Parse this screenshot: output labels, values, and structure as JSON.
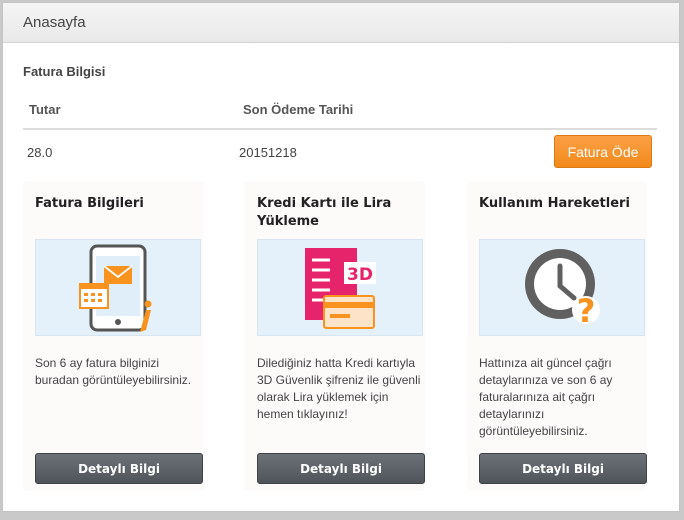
{
  "header": {
    "title": "Anasayfa"
  },
  "invoice": {
    "section_title": "Fatura Bilgisi",
    "columns": [
      "Tutar",
      "Son Ödeme Tarihi"
    ],
    "row": {
      "amount": "28.0",
      "due_date": "20151218"
    },
    "pay_label": "Fatura Öde"
  },
  "cards": [
    {
      "title": "Fatura Bilgileri",
      "icon": "phone-invoice-icon",
      "description": "Son 6 ay fatura bilginizi buradan görüntüleyebilirsiniz.",
      "button_label": "Detaylı Bilgi"
    },
    {
      "title": "Kredi Kartı ile Lira Yükleme",
      "icon": "credit-card-3d-icon",
      "description": "Dilediğiniz hatta Kredi kartıyla 3D Güvenlik şifreniz ile güvenli olarak Lira yüklemek için hemen tıklayınız!",
      "button_label": "Detaylı Bilgi"
    },
    {
      "title": "Kullanım Hareketleri",
      "icon": "clock-question-icon",
      "description": "Hattınıza ait güncel çağrı detaylarınıza ve son 6 ay faturalarınıza ait çağrı detaylarınızı görüntüleyebilirsiniz.",
      "button_label": "Detaylı Bilgi"
    }
  ],
  "colors": {
    "accent_orange": "#f7931e",
    "button_gray": "#5a6065",
    "image_bg": "#e4f1fb",
    "card_pink": "#e5246b"
  }
}
